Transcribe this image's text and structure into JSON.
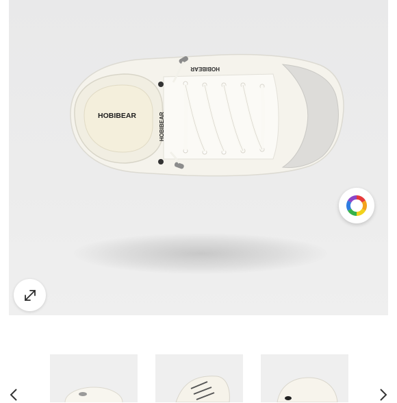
{
  "product": {
    "brand_inner_label": "HOBIBEAR",
    "brand_tongue_label": "HOBIBEAR",
    "brand_side_label": "HOBIBEAR"
  },
  "controls": {
    "expand_icon": "expand-arrows-icon",
    "color_picker_icon": "color-wheel-icon"
  },
  "thumbnails": {
    "count": 3,
    "prev_icon": "chevron-left-icon",
    "next_icon": "chevron-right-icon"
  },
  "colors": {
    "image_bg": "#ebebeb",
    "shoe_body": "#f7f5ef",
    "suede_patch": "#dcdcda"
  }
}
